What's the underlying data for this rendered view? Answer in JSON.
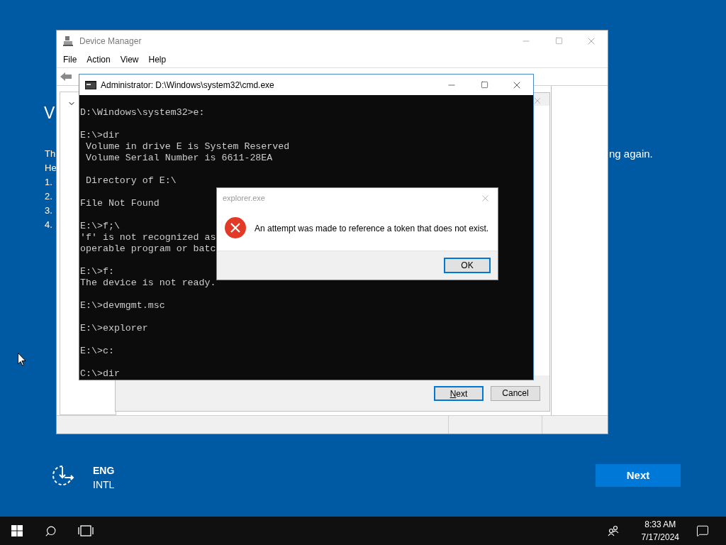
{
  "setup": {
    "heading": "V",
    "paragraph_lines": [
      "Th",
      "He"
    ],
    "steps": [
      "1.",
      "2.",
      "3.",
      "4."
    ],
    "right_fragment": "ng again.",
    "keyboard": {
      "language": "ENG",
      "layout": "INTL"
    },
    "next_button": "Next"
  },
  "device_manager": {
    "title": "Device Manager",
    "menu": [
      "File",
      "Action",
      "View",
      "Help"
    ],
    "wizard": {
      "buttons": [
        {
          "label": "Next",
          "default": true
        },
        {
          "label": "Cancel",
          "default": false
        }
      ]
    }
  },
  "cmd": {
    "title": "Administrator: D:\\Windows\\system32\\cmd.exe",
    "blocks": [
      [
        "D:\\Windows\\system32>e:"
      ],
      [
        "E:\\>dir",
        " Volume in drive E is System Reserved",
        " Volume Serial Number is 6611-28EA"
      ],
      [
        " Directory of E:\\"
      ],
      [
        "File Not Found"
      ],
      [
        "E:\\>f;\\",
        "'f' is not recognized as",
        "operable program or batc"
      ],
      [
        "E:\\>f:",
        "The device is not ready."
      ],
      [
        "E:\\>devmgmt.msc"
      ],
      [
        "E:\\>explorer"
      ],
      [
        "E:\\>c:"
      ],
      [
        "C:\\>dir"
      ]
    ]
  },
  "error_dialog": {
    "title": "explorer.exe",
    "message": "An attempt was made to reference a token that does not exist.",
    "button": "OK"
  },
  "taskbar": {
    "time": "8:33 AM",
    "date": "7/17/2024"
  }
}
